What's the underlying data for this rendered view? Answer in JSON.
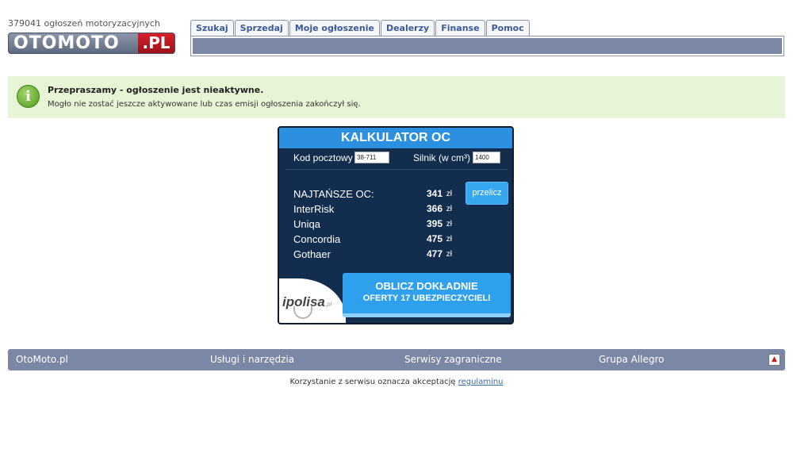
{
  "header": {
    "ad_count": "379041 ogłoszeń motoryzacyjnych",
    "logo_main": "OTOMOTO",
    "logo_tld": ".PL"
  },
  "tabs": [
    "Szukaj",
    "Sprzedaj",
    "Moje ogłoszenie",
    "Dealerzy",
    "Finanse",
    "Pomoc"
  ],
  "notice": {
    "icon": "info-icon",
    "title": "Przepraszamy - ogłoszenie jest nieaktywne.",
    "text": "Mogło nie zostać jeszcze aktywowane lub czas emisji ogłoszenia zakończył się."
  },
  "calculator": {
    "title": "KALKULATOR OC",
    "postal_label": "Kod pocztowy",
    "postal_value": "38-711",
    "engine_label": "Silnik (w cm³)",
    "engine_value": "1400",
    "recalc_label": "przelicz",
    "currency": "zł",
    "rows": [
      {
        "name": "NAJTAŃSZE OC:",
        "price": "341"
      },
      {
        "name": "InterRisk",
        "price": "366"
      },
      {
        "name": "Uniqa",
        "price": "395"
      },
      {
        "name": "Concordia",
        "price": "475"
      },
      {
        "name": "Gothaer",
        "price": "477"
      }
    ],
    "brand": "ipolisa",
    "brand_suffix": ".pl",
    "cta_line1": "OBLICZ DOKŁADNIE",
    "cta_line2": "OFERTY 17 UBEZPIECZYCIELI"
  },
  "footer": {
    "links": [
      "OtoMoto.pl",
      "Usługi i narzędzia",
      "Serwisy zagraniczne",
      "Grupa Allegro"
    ],
    "terms_text": "Korzystanie z serwisu oznacza akceptację",
    "terms_link": "regulaminu"
  },
  "colors": {
    "nav_bar": "#7a87a5",
    "notice_bg": "#e7f5d6",
    "calc_bg": "#132d4f",
    "calc_header": "#2d8fe0",
    "button": "#2fa0ee"
  }
}
